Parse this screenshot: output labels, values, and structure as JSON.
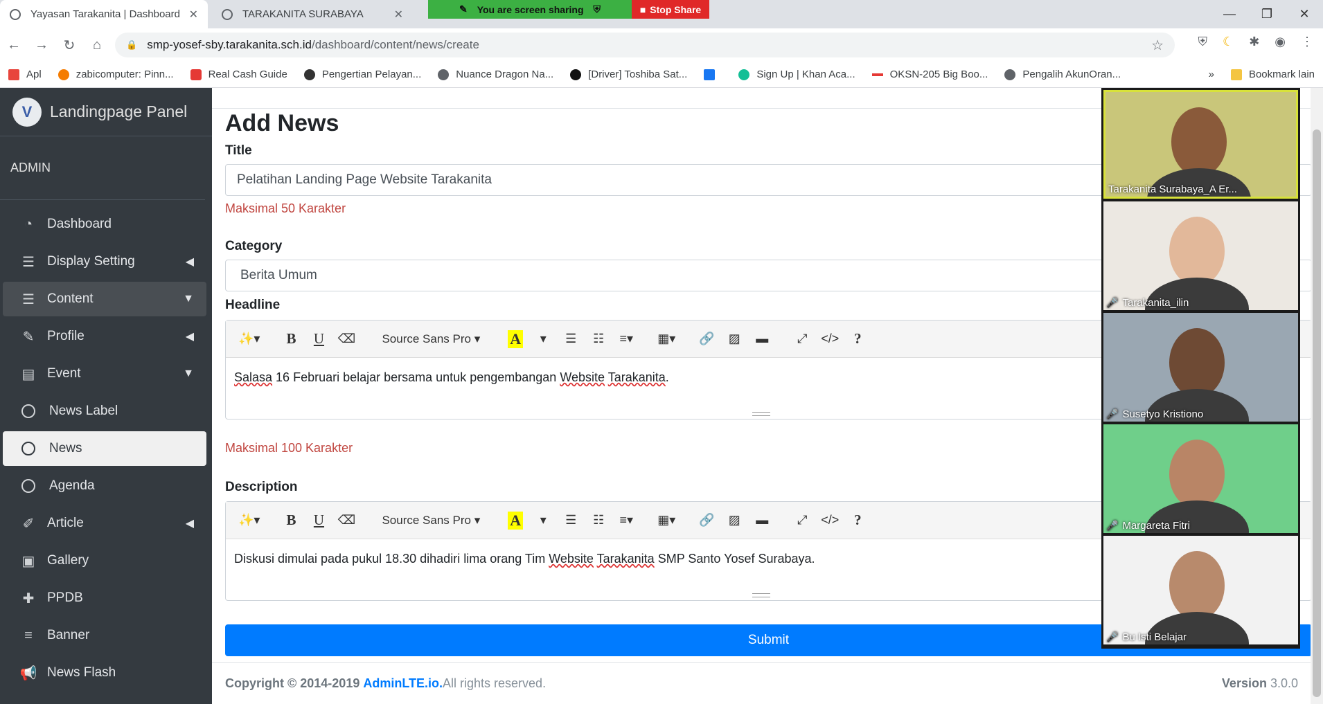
{
  "browser": {
    "tabs": [
      {
        "title": "Yayasan Tarakanita | Dashboard",
        "active": true
      },
      {
        "title": "TARAKANITA SURABAYA",
        "active": false
      }
    ],
    "sharing": {
      "status": "You are screen sharing",
      "stop": "Stop Share"
    },
    "url_host": "smp-yosef-sby.tarakanita.sch.id",
    "url_path": "/dashboard/content/news/create",
    "bookmarks": [
      {
        "label": "Apl",
        "color": "#e8453c"
      },
      {
        "label": "zabicomputer: Pinn...",
        "color": "#f57c00"
      },
      {
        "label": "Real Cash Guide",
        "color": "#e53935"
      },
      {
        "label": "Pengertian Pelayan...",
        "color": "#333333"
      },
      {
        "label": "Nuance Dragon Na...",
        "color": "#5f6368"
      },
      {
        "label": "[Driver] Toshiba Sat...",
        "color": "#111111"
      },
      {
        "label": "Sign Up | Khan Aca...",
        "color": "#14bf96"
      },
      {
        "label": "OKSN-205 Big Boo...",
        "color": "#e53935"
      },
      {
        "label": "Pengalih AkunOran...",
        "color": "#5f6368"
      }
    ],
    "bookmarks_other": "Bookmark lain"
  },
  "sidebar": {
    "brand": "Landingpage Panel",
    "user": "ADMIN",
    "items": [
      {
        "label": "Dashboard",
        "icon": "tachometer-icon",
        "glyph": "◔",
        "caret": "",
        "state": ""
      },
      {
        "label": "Display Setting",
        "icon": "list-icon",
        "glyph": "☰",
        "caret": "◀",
        "state": ""
      },
      {
        "label": "Content",
        "icon": "list-icon",
        "glyph": "☰",
        "caret": "▼",
        "state": "open"
      },
      {
        "label": "Profile",
        "icon": "edit-icon",
        "glyph": "✎",
        "caret": "◀",
        "state": ""
      },
      {
        "label": "Event",
        "icon": "list-alt-icon",
        "glyph": "▤",
        "caret": "▼",
        "state": ""
      },
      {
        "label": "News Label",
        "icon": "circle-icon",
        "glyph": "",
        "caret": "",
        "state": "circle"
      },
      {
        "label": "News",
        "icon": "circle-icon",
        "glyph": "",
        "caret": "",
        "state": "active"
      },
      {
        "label": "Agenda",
        "icon": "circle-icon",
        "glyph": "",
        "caret": "",
        "state": "circle"
      },
      {
        "label": "Article",
        "icon": "pencil-icon",
        "glyph": "✐",
        "caret": "◀",
        "state": ""
      },
      {
        "label": "Gallery",
        "icon": "images-icon",
        "glyph": "▣",
        "caret": "",
        "state": ""
      },
      {
        "label": "PPDB",
        "icon": "user-plus-icon",
        "glyph": "✚",
        "caret": "",
        "state": ""
      },
      {
        "label": "Banner",
        "icon": "sliders-icon",
        "glyph": "≡",
        "caret": "",
        "state": ""
      },
      {
        "label": "News Flash",
        "icon": "bullhorn-icon",
        "glyph": "📢",
        "caret": "",
        "state": ""
      }
    ]
  },
  "form": {
    "page_title": "Add News",
    "title_label": "Title",
    "title_value": "Pelatihan Landing Page Website Tarakanita",
    "title_hint": "Maksimal 50 Karakter",
    "category_label": "Category",
    "category_value": "Berita Umum",
    "headline_label": "Headline",
    "headline_hint": "Maksimal 100 Karakter",
    "description_label": "Description",
    "font_name": "Source Sans Pro",
    "submit": "Submit"
  },
  "headline_text": {
    "w1": "Salasa",
    "p1": " 16 Februari belajar bersama untuk pengembangan ",
    "w2": "Website",
    "p2": " ",
    "w3": "Tarakanita",
    "p3": "."
  },
  "description_text": {
    "p1": "Diskusi dimulai pada pukul 18.30 dihadiri lima orang Tim ",
    "w1": "Website",
    "p2": " ",
    "w2": "Tarakanita",
    "p3": " SMP Santo Yosef Surabaya."
  },
  "footer": {
    "copyright": "Copyright © 2014-2019 ",
    "link": "AdminLTE.io.",
    "rights": " All rights reserved.",
    "version_label": "Version",
    "version": " 3.0.0"
  },
  "participants": [
    {
      "name": "Tarakanita Surabaya_A Er...",
      "muted": false,
      "bg": "#c9c67a",
      "skin": "#8a5a3a"
    },
    {
      "name": "Tarakanita_ilin",
      "muted": true,
      "bg": "#ece8e2",
      "skin": "#e2b89a"
    },
    {
      "name": "Susetyo Kristiono",
      "muted": true,
      "bg": "#9aa7b2",
      "skin": "#6e4a34"
    },
    {
      "name": "Margareta Fitri",
      "muted": true,
      "bg": "#6fcf8a",
      "skin": "#b98566"
    },
    {
      "name": "Bu Isti Belajar",
      "muted": true,
      "bg": "#f2f2f2",
      "skin": "#b88a6c"
    }
  ]
}
